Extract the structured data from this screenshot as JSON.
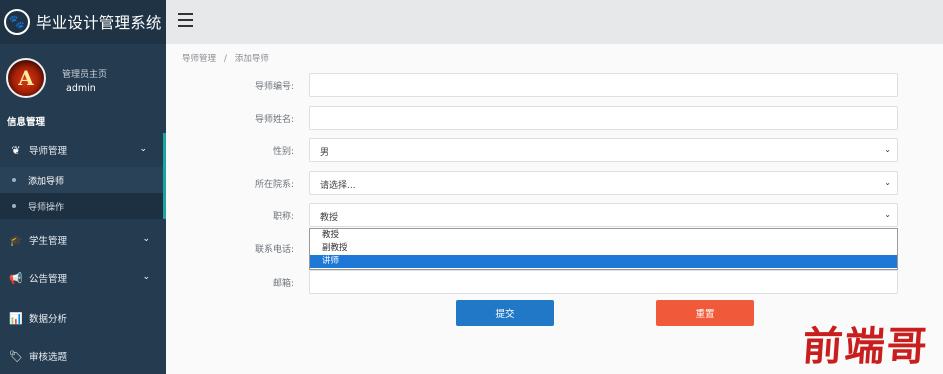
{
  "app": {
    "title": "毕业设计管理系统",
    "logo_icon": "paw-icon"
  },
  "user": {
    "avatar_letter": "A",
    "role": "管理员主页",
    "name": "admin"
  },
  "sidebar": {
    "section_title": "信息管理",
    "items": [
      {
        "label": "导师管理",
        "icon": "leaf-icon",
        "glyph": "❦",
        "expanded": true,
        "children": [
          {
            "label": "添加导师",
            "current": true
          },
          {
            "label": "导师操作",
            "current": false
          }
        ]
      },
      {
        "label": "学生管理",
        "icon": "graduation-cap-icon",
        "glyph": "🎓"
      },
      {
        "label": "公告管理",
        "icon": "bullhorn-icon",
        "glyph": "📢"
      },
      {
        "label": "数据分析",
        "icon": "bar-chart-icon",
        "glyph": "📊"
      },
      {
        "label": "审核选题",
        "icon": "tags-icon",
        "glyph": "🏷"
      }
    ]
  },
  "breadcrumb": {
    "parent": "导师管理",
    "separator": "/",
    "current": "添加导师"
  },
  "form": {
    "teacher_id": {
      "label": "导师编号:",
      "value": ""
    },
    "teacher_name": {
      "label": "导师姓名:",
      "value": ""
    },
    "gender": {
      "label": "性别:",
      "value": "男"
    },
    "department": {
      "label": "所在院系:",
      "value": "请选择..."
    },
    "title": {
      "label": "职称:",
      "value": "教授",
      "options": [
        "教授",
        "副教授",
        "讲师"
      ],
      "highlighted": "讲师"
    },
    "phone": {
      "label": "联系电话:",
      "value": ""
    },
    "email": {
      "label": "邮箱:",
      "value": ""
    }
  },
  "buttons": {
    "submit": "提交",
    "reset": "重置"
  },
  "watermark": "前端哥",
  "colors": {
    "sidebar": "#253b4f",
    "accent": "#19a6a0",
    "submit": "#2178c6",
    "reset": "#f05a3a",
    "highlight": "#1e78d6"
  }
}
